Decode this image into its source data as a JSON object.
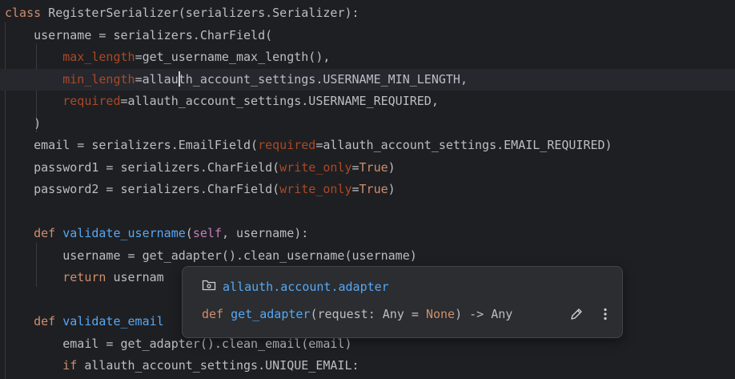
{
  "editor": {
    "lines": [
      {
        "segments": [
          {
            "c": "kw",
            "t": "class "
          },
          {
            "c": "txt",
            "t": "RegisterSerializer(serializers.Serializer):"
          }
        ]
      },
      {
        "segments": [
          {
            "c": "txt",
            "t": "    username = serializers.CharField("
          }
        ]
      },
      {
        "segments": [
          {
            "c": "named",
            "t": "        max_length"
          },
          {
            "c": "txt",
            "t": "=get_username_max_length(),"
          }
        ]
      },
      {
        "segments": [
          {
            "c": "named",
            "t": "        min_length"
          },
          {
            "c": "txt",
            "t": "=allau"
          },
          {
            "c": "caret",
            "t": ""
          },
          {
            "c": "txt",
            "t": "th_account_settings.USERNAME_MIN_LENGTH,"
          }
        ]
      },
      {
        "segments": [
          {
            "c": "named",
            "t": "        required"
          },
          {
            "c": "txt",
            "t": "=allauth_account_settings.USERNAME_REQUIRED,"
          }
        ]
      },
      {
        "segments": [
          {
            "c": "txt",
            "t": "    )"
          }
        ]
      },
      {
        "segments": [
          {
            "c": "txt",
            "t": "    email = serializers.EmailField("
          },
          {
            "c": "named",
            "t": "required"
          },
          {
            "c": "txt",
            "t": "=allauth_account_settings.EMAIL_REQUIRED)"
          }
        ]
      },
      {
        "segments": [
          {
            "c": "txt",
            "t": "    password1 = serializers.CharField("
          },
          {
            "c": "named",
            "t": "write_only"
          },
          {
            "c": "txt",
            "t": "="
          },
          {
            "c": "kw",
            "t": "True"
          },
          {
            "c": "txt",
            "t": ")"
          }
        ]
      },
      {
        "segments": [
          {
            "c": "txt",
            "t": "    password2 = serializers.CharField("
          },
          {
            "c": "named",
            "t": "write_only"
          },
          {
            "c": "txt",
            "t": "="
          },
          {
            "c": "kw",
            "t": "True"
          },
          {
            "c": "txt",
            "t": ")"
          }
        ]
      },
      {
        "segments": [
          {
            "c": "txt",
            "t": ""
          }
        ]
      },
      {
        "segments": [
          {
            "c": "kw",
            "t": "    def "
          },
          {
            "c": "fn",
            "t": "validate_username"
          },
          {
            "c": "txt",
            "t": "("
          },
          {
            "c": "param",
            "t": "self"
          },
          {
            "c": "txt",
            "t": ", username):"
          }
        ]
      },
      {
        "segments": [
          {
            "c": "txt",
            "t": "        username = get_adapter().clean_username(username)"
          }
        ]
      },
      {
        "segments": [
          {
            "c": "kw",
            "t": "        return "
          },
          {
            "c": "txt",
            "t": "usernam"
          }
        ]
      },
      {
        "segments": [
          {
            "c": "txt",
            "t": ""
          }
        ]
      },
      {
        "segments": [
          {
            "c": "kw",
            "t": "    def "
          },
          {
            "c": "fn",
            "t": "validate_email"
          }
        ]
      },
      {
        "segments": [
          {
            "c": "txt",
            "t": "        email = get_adapter().clean_email(email)"
          }
        ]
      },
      {
        "segments": [
          {
            "c": "kw",
            "t": "        if "
          },
          {
            "c": "txt",
            "t": "allauth_account_settings.UNIQUE_EMAIL:"
          }
        ]
      }
    ]
  },
  "popup": {
    "package_icon": "package-icon",
    "package_name": "allauth.account.adapter",
    "signature": [
      {
        "c": "kw",
        "t": "def "
      },
      {
        "c": "fn",
        "t": "get_adapter"
      },
      {
        "c": "txt",
        "t": "(request: Any = "
      },
      {
        "c": "kw",
        "t": "None"
      },
      {
        "c": "txt",
        "t": ") -> Any"
      }
    ],
    "edit_icon": "pencil-icon",
    "more_icon": "more-vertical-icon"
  },
  "colors": {
    "background": "#1e1f22",
    "keyword": "#cf8e6d",
    "function": "#56a8f5",
    "named_arg": "#aa4926",
    "self": "#c77dbb",
    "text": "#bcbec4"
  }
}
